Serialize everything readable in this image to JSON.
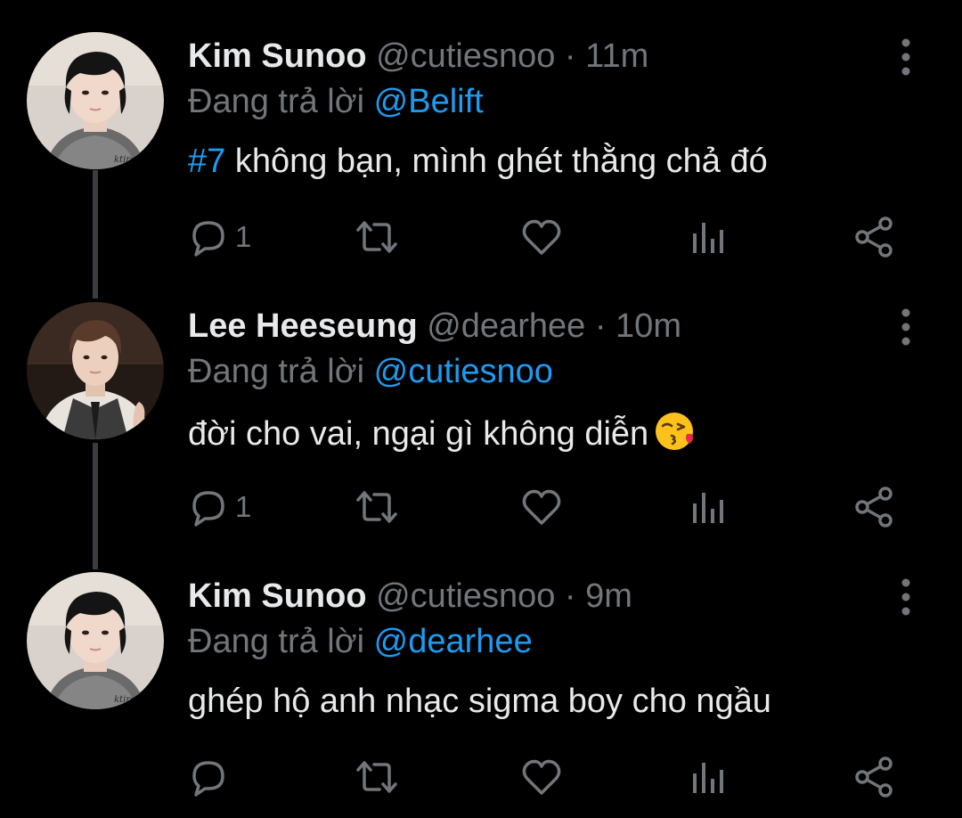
{
  "labels": {
    "reply_prefix": "Đang trả lời",
    "separator": "·"
  },
  "colors": {
    "background": "#000000",
    "text": "#e7e9ea",
    "secondary": "#71767b",
    "accent": "#1d9bf0",
    "thread_line": "#3a3d40"
  },
  "icons": [
    "reply-icon",
    "retweet-icon",
    "like-icon",
    "views-icon",
    "share-icon",
    "more-options-icon"
  ],
  "tweets": [
    {
      "name": "Kim Sunoo",
      "handle": "@cutiesnoo",
      "time": "11m",
      "replying_to": "@Belift",
      "hashtag": "#7",
      "text": " không bạn, mình ghét thằng chả đó",
      "reply_count": "1"
    },
    {
      "name": "Lee Heeseung",
      "handle": "@dearhee",
      "time": "10m",
      "replying_to": "@cutiesnoo",
      "text": "đời cho vai, ngại gì không diễn",
      "emoji": "face-blowing-a-kiss",
      "reply_count": "1"
    },
    {
      "name": "Kim Sunoo",
      "handle": "@cutiesnoo",
      "time": "9m",
      "replying_to": "@dearhee",
      "text": "ghép hộ anh nhạc sigma boy cho ngầu",
      "reply_count": ""
    }
  ]
}
